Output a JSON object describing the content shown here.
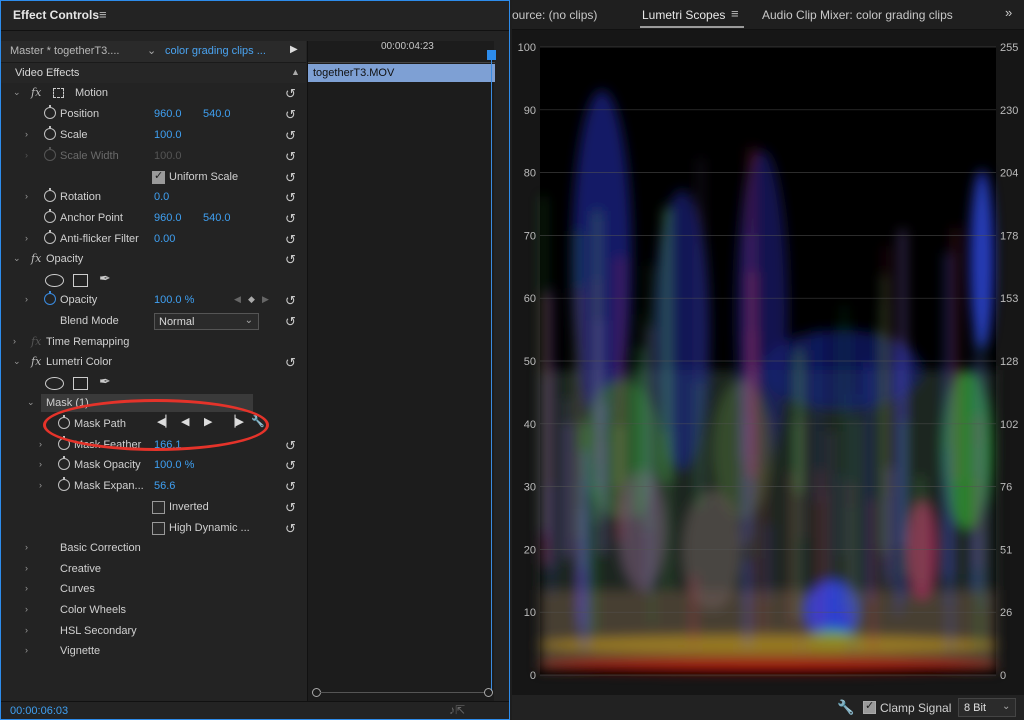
{
  "effect_controls": {
    "title": "Effect Controls",
    "menu_icon": "≡",
    "source_master": "Master * togetherT3....",
    "source_clip": "color grading clips ...",
    "timecode_ruler": "00:00:04:23",
    "clip_name": "togetherT3.MOV",
    "video_effects_label": "Video Effects",
    "footer_timecode": "00:00:06:03",
    "rows": {
      "motion": "Motion",
      "position": "Position",
      "position_x": "960.0",
      "position_y": "540.0",
      "scale": "Scale",
      "scale_val": "100.0",
      "scale_width": "Scale Width",
      "scale_width_val": "100.0",
      "uniform_scale": "Uniform Scale",
      "rotation": "Rotation",
      "rotation_val": "0.0",
      "anchor": "Anchor Point",
      "anchor_x": "960.0",
      "anchor_y": "540.0",
      "antiflicker": "Anti-flicker Filter",
      "antiflicker_val": "0.00",
      "opacity_fx": "Opacity",
      "opacity": "Opacity",
      "opacity_val": "100.0 %",
      "blend_mode": "Blend Mode",
      "blend_mode_val": "Normal",
      "time_remap": "Time Remapping",
      "lumetri": "Lumetri Color",
      "mask": "Mask (1)",
      "mask_path": "Mask Path",
      "mask_feather": "Mask Feather",
      "mask_feather_val": "166.1",
      "mask_opacity": "Mask Opacity",
      "mask_opacity_val": "100.0 %",
      "mask_expansion": "Mask Expan...",
      "mask_expansion_val": "56.6",
      "inverted": "Inverted",
      "hdr": "High Dynamic ...",
      "basic_correction": "Basic Correction",
      "creative": "Creative",
      "curves": "Curves",
      "color_wheels": "Color Wheels",
      "hsl_secondary": "HSL Secondary",
      "vignette": "Vignette"
    }
  },
  "scopes": {
    "tab_source": "ource: (no clips)",
    "tab_lumetri": "Lumetri Scopes",
    "tab_audio": "Audio Clip Mixer: color grading clips",
    "left_axis": [
      "100",
      "90",
      "80",
      "70",
      "60",
      "50",
      "40",
      "30",
      "20",
      "10",
      "0"
    ],
    "right_axis": [
      "255",
      "230",
      "204",
      "178",
      "153",
      "128",
      "102",
      "76",
      "51",
      "26",
      "0"
    ],
    "clamp_signal": "Clamp Signal",
    "clamp_checked": true,
    "bit_depth": "8 Bit"
  }
}
